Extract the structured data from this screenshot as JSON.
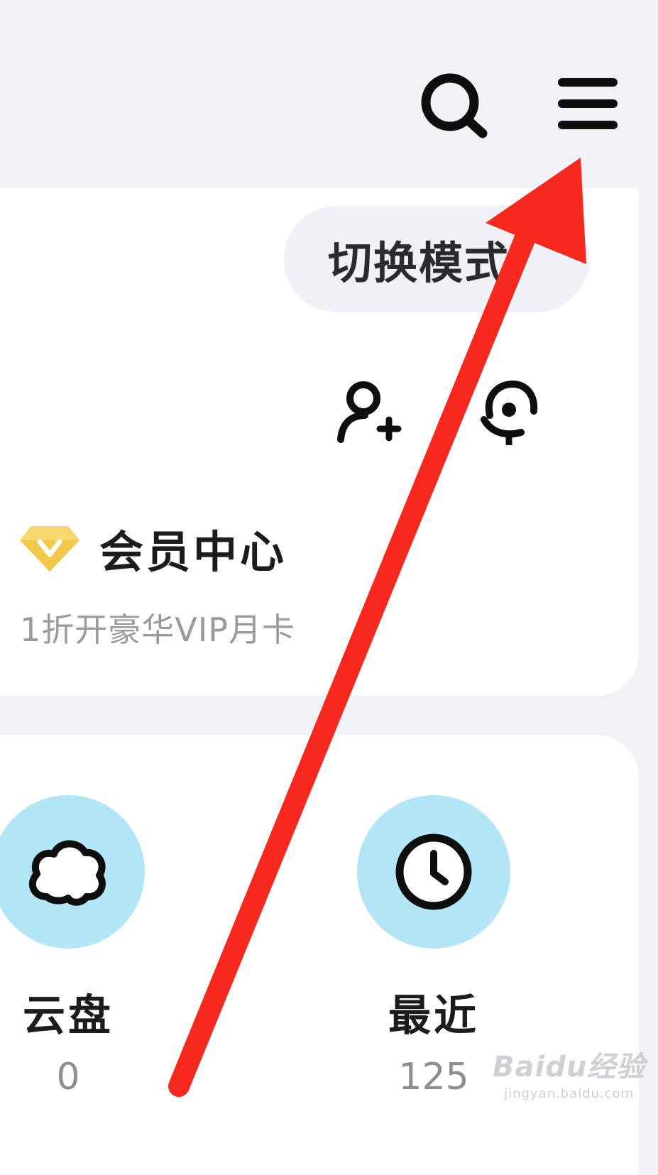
{
  "header": {
    "search_icon": "search-icon",
    "menu_icon": "hamburger-menu-icon"
  },
  "profile": {
    "switch_mode_label": "切换模式",
    "actions": [
      "add-friend-icon",
      "customer-service-icon"
    ],
    "vip": {
      "icon": "vip-diamond-icon",
      "title": "会员中心",
      "subtitle": "1折开豪华VIP月卡"
    }
  },
  "shortcuts": [
    {
      "label": "云盘",
      "count": "0",
      "icon": "cloud-icon"
    },
    {
      "label": "最近",
      "count": "125",
      "icon": "clock-icon"
    }
  ],
  "annotation": {
    "arrow_color": "#f7291f",
    "description_icon": "red-arrow-pointing-to-menu"
  },
  "watermark": {
    "text": "Baidu经验",
    "url": "jingyan.baidu.com"
  },
  "colors": {
    "background": "#f1f2f6",
    "card": "#ffffff",
    "accent_blue": "#b2e6f7",
    "vip_gold": "#f2c84b",
    "muted_text": "#9a9a9e"
  }
}
